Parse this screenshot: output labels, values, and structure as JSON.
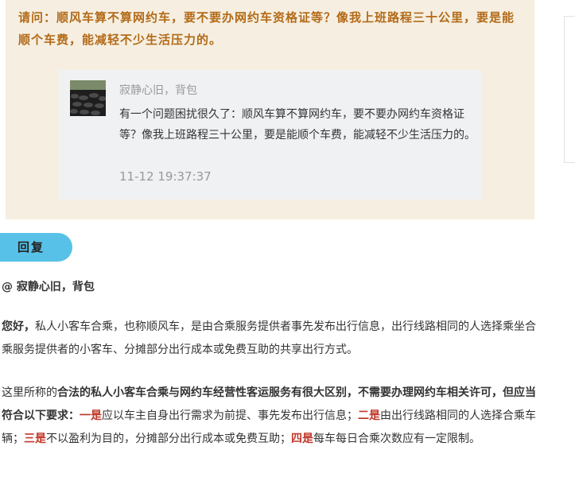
{
  "question": {
    "text": "请问：顺风车算不算网约车，要不要办网约车资格证等？像我上班路程三十公里，要是能顺个车费，能减轻不少生活压力的。"
  },
  "quote": {
    "author": "寂静心旧，背包",
    "content": "有一个问题困扰很久了：顺风车算不算网约车，要不要办网约车资格证等？像我上班路程三十公里，要是能顺个车费，能减轻不少生活压力的。",
    "time": "11-12 19:37:37"
  },
  "reply": {
    "button_label": "回复",
    "mention": "@ 寂静心旧，背包",
    "p1_lead": "您好，",
    "p1_body": "私人小客车合乘，也称顺风车，是由合乘服务提供者事先发布出行信息，出行线路相同的人选择乘坐合乘服务提供者的小客车、分摊部分出行成本或免费互助的共享出行方式。",
    "p2_intro": "这里所称的",
    "p2_bold": "合法的私人小客车合乘与网约车经营性客运服务有很大区别，不需要办理网约车相关许可，但应当符合以下要求：",
    "r1_label": "一是",
    "r1_text": "应以车主自身出行需求为前提、事先发布出行信息；",
    "r2_label": "二是",
    "r2_text": "由出行线路相同的人选择合乘车辆；",
    "r3_label": "三是",
    "r3_text": "不以盈利为目的，分摊部分出行成本或免费互助；",
    "r4_label": "四是",
    "r4_text": "每车每日合乘次数应有一定限制。"
  },
  "colors": {
    "question_bg": "#f6efe1",
    "question_text": "#b26a18",
    "reply_button": "#58c1e7",
    "highlight_red": "#c0392b"
  }
}
